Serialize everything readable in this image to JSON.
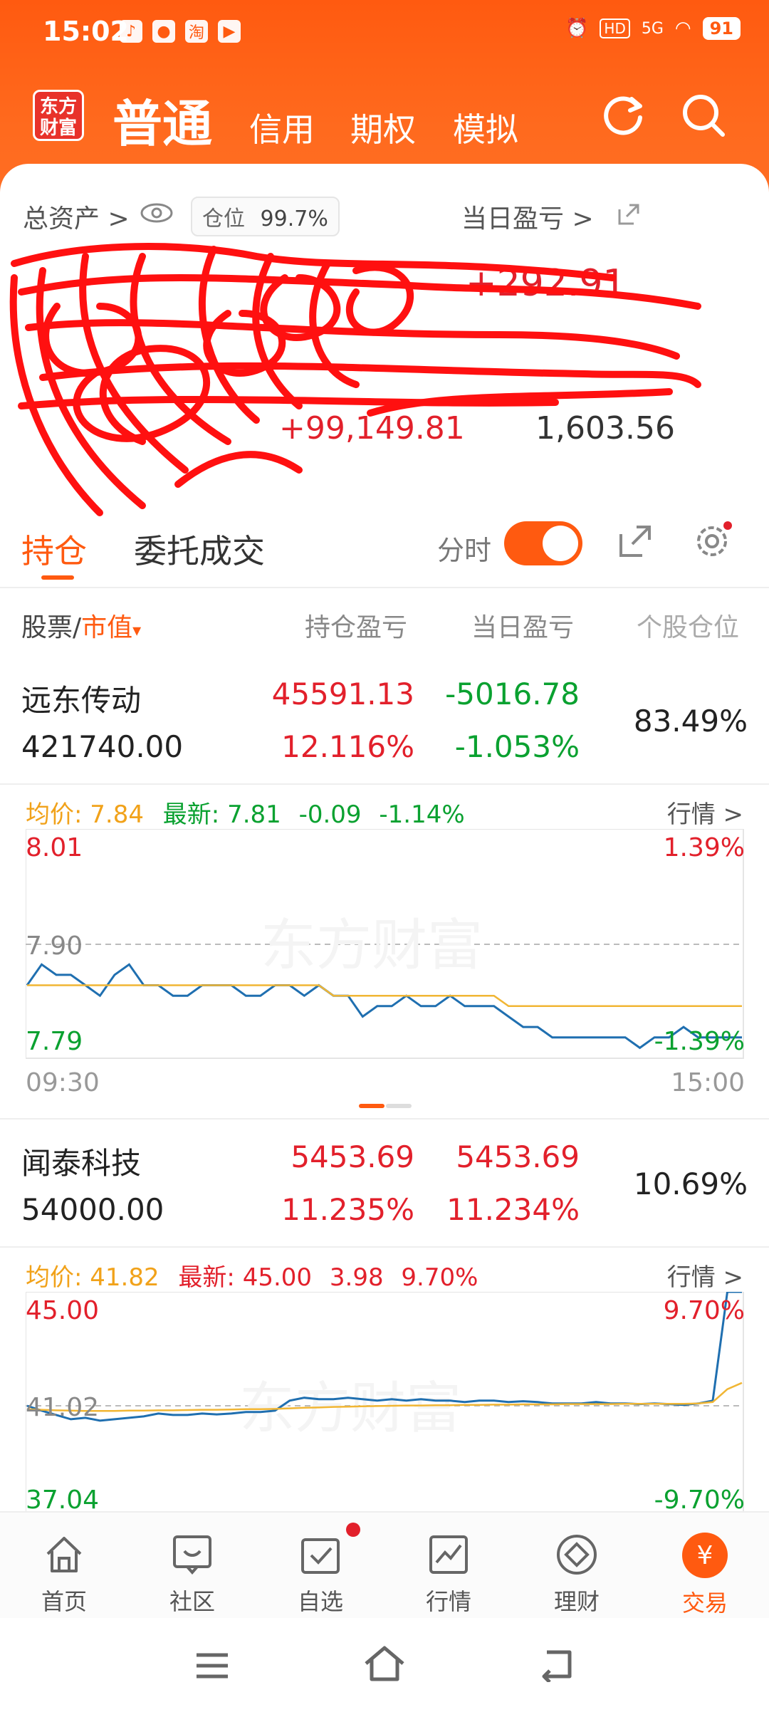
{
  "status_bar": {
    "time": "15:02",
    "battery": "91",
    "network": "5G"
  },
  "header": {
    "logo_line1": "东方",
    "logo_line2": "财富",
    "tabs": [
      "普通",
      "信用",
      "期权",
      "模拟"
    ]
  },
  "summary": {
    "total_assets_label": "总资产 >",
    "position_label": "仓位",
    "position_value": "99.7%",
    "daily_pnl_label": "当日盈亏 >",
    "daily_pnl_value": "+292.91",
    "holding_pnl_value": "+99,149.81",
    "third_value": "1,603.56"
  },
  "subtabs": {
    "holdings": "持仓",
    "orders": "委托成交",
    "fenshi_label": "分时"
  },
  "columns": {
    "stock": "股票/",
    "market_value": "市值",
    "holding_pnl": "持仓盈亏",
    "daily_pnl": "当日盈亏",
    "position": "个股仓位"
  },
  "stocks": [
    {
      "name": "远东传动",
      "market_value": "421740.00",
      "holding_pnl": "45591.13",
      "holding_pnl_pct": "12.116%",
      "daily_pnl": "-5016.78",
      "daily_pnl_pct": "-1.053%",
      "position": "83.49%",
      "avg_label": "均价:",
      "avg": "7.84",
      "last_label": "最新:",
      "last": "7.81",
      "change": "-0.09",
      "change_pct": "-1.14%",
      "quote_link": "行情 >",
      "chart": {
        "y_top": "8.01",
        "y_mid": "7.90",
        "y_bottom": "7.79",
        "pct_top": "1.39%",
        "pct_bottom": "-1.39%",
        "x_start": "09:30",
        "x_end": "15:00"
      }
    },
    {
      "name": "闻泰科技",
      "market_value": "54000.00",
      "holding_pnl": "5453.69",
      "holding_pnl_pct": "11.235%",
      "daily_pnl": "5453.69",
      "daily_pnl_pct": "11.234%",
      "position": "10.69%",
      "avg_label": "均价:",
      "avg": "41.82",
      "last_label": "最新:",
      "last": "45.00",
      "change": "3.98",
      "change_pct": "9.70%",
      "quote_link": "行情 >",
      "chart": {
        "y_top": "45.00",
        "y_mid": "41.02",
        "y_bottom": "37.04",
        "pct_top": "9.70%",
        "pct_bottom": "-9.70%"
      }
    }
  ],
  "chart_data": [
    {
      "type": "line",
      "title": "远东传动",
      "x": [
        "09:30",
        "15:00"
      ],
      "ylim": [
        7.79,
        8.01
      ],
      "series": [
        {
          "name": "最新",
          "values": [
            7.86,
            7.88,
            7.87,
            7.87,
            7.86,
            7.85,
            7.87,
            7.88,
            7.86,
            7.86,
            7.85,
            7.85,
            7.86,
            7.86,
            7.86,
            7.85,
            7.85,
            7.86,
            7.86,
            7.85,
            7.86,
            7.85,
            7.85,
            7.83,
            7.84,
            7.84,
            7.85,
            7.84,
            7.84,
            7.85,
            7.84,
            7.84,
            7.84,
            7.83,
            7.82,
            7.82,
            7.81,
            7.81,
            7.81,
            7.81,
            7.81,
            7.81,
            7.8,
            7.81,
            7.81,
            7.82,
            7.81,
            7.81,
            7.81,
            7.81
          ]
        },
        {
          "name": "均价",
          "values": [
            7.86,
            7.86,
            7.86,
            7.86,
            7.86,
            7.86,
            7.86,
            7.86,
            7.86,
            7.86,
            7.86,
            7.86,
            7.86,
            7.86,
            7.86,
            7.86,
            7.86,
            7.86,
            7.86,
            7.86,
            7.86,
            7.85,
            7.85,
            7.85,
            7.85,
            7.85,
            7.85,
            7.85,
            7.85,
            7.85,
            7.85,
            7.85,
            7.85,
            7.84,
            7.84,
            7.84,
            7.84,
            7.84,
            7.84,
            7.84,
            7.84,
            7.84,
            7.84,
            7.84,
            7.84,
            7.84,
            7.84,
            7.84,
            7.84,
            7.84
          ]
        }
      ]
    },
    {
      "type": "line",
      "title": "闻泰科技",
      "ylim": [
        37.04,
        45.0
      ],
      "series": [
        {
          "name": "最新",
          "values": [
            41.02,
            40.85,
            40.7,
            40.55,
            40.6,
            40.5,
            40.55,
            40.6,
            40.65,
            40.75,
            40.7,
            40.7,
            40.75,
            40.72,
            40.75,
            40.8,
            40.8,
            40.85,
            41.2,
            41.3,
            41.25,
            41.25,
            41.3,
            41.25,
            41.2,
            41.25,
            41.2,
            41.25,
            41.2,
            41.2,
            41.15,
            41.2,
            41.2,
            41.15,
            41.18,
            41.15,
            41.1,
            41.1,
            41.1,
            41.15,
            41.1,
            41.1,
            41.08,
            41.1,
            41.08,
            41.05,
            41.1,
            41.2,
            45.0,
            45.0
          ]
        },
        {
          "name": "均价",
          "values": [
            40.9,
            40.88,
            40.86,
            40.85,
            40.84,
            40.84,
            40.84,
            40.85,
            40.85,
            40.86,
            40.86,
            40.87,
            40.88,
            40.88,
            40.89,
            40.9,
            40.9,
            40.91,
            40.93,
            40.95,
            40.96,
            40.98,
            40.99,
            41.0,
            41.01,
            41.02,
            41.03,
            41.03,
            41.04,
            41.04,
            41.05,
            41.05,
            41.06,
            41.06,
            41.07,
            41.07,
            41.07,
            41.08,
            41.08,
            41.08,
            41.08,
            41.09,
            41.09,
            41.09,
            41.09,
            41.09,
            41.1,
            41.15,
            41.6,
            41.82
          ]
        }
      ]
    }
  ],
  "nav": {
    "items": [
      {
        "label": "首页",
        "icon": "home-icon"
      },
      {
        "label": "社区",
        "icon": "community-icon"
      },
      {
        "label": "自选",
        "icon": "watchlist-icon"
      },
      {
        "label": "行情",
        "icon": "market-icon"
      },
      {
        "label": "理财",
        "icon": "wealth-icon"
      },
      {
        "label": "交易",
        "icon": "trade-icon"
      }
    ],
    "trade_symbol": "¥"
  },
  "colors": {
    "brand": "#ff5a10",
    "up": "#e2202b",
    "down": "#0aa130",
    "avg_line": "#f1b634",
    "price_line": "#1f6fb0"
  }
}
